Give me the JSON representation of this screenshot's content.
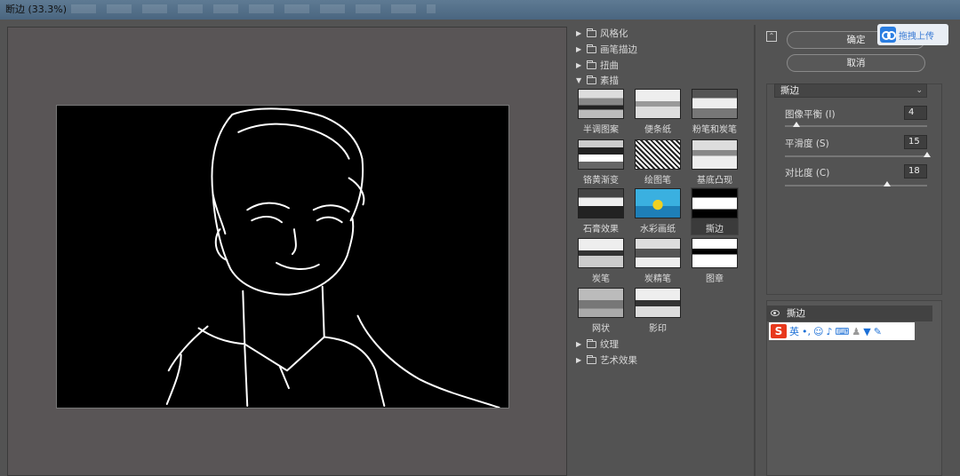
{
  "window": {
    "title": "断边 (33.3%)"
  },
  "filter_gallery": {
    "categories_top": [
      {
        "label": "风格化",
        "expanded": false
      },
      {
        "label": "画笔描边",
        "expanded": false
      },
      {
        "label": "扭曲",
        "expanded": false
      },
      {
        "label": "素描",
        "expanded": true
      }
    ],
    "thumbnails": [
      {
        "label": "半调图案"
      },
      {
        "label": "便条纸"
      },
      {
        "label": "粉笔和炭笔"
      },
      {
        "label": "铬黄渐变"
      },
      {
        "label": "绘图笔"
      },
      {
        "label": "基底凸现"
      },
      {
        "label": "石膏效果"
      },
      {
        "label": "水彩画纸"
      },
      {
        "label": "撕边"
      },
      {
        "label": "炭笔"
      },
      {
        "label": "炭精笔"
      },
      {
        "label": "图章"
      },
      {
        "label": "网状"
      },
      {
        "label": "影印"
      }
    ],
    "categories_bottom": [
      {
        "label": "纹理",
        "expanded": false
      },
      {
        "label": "艺术效果",
        "expanded": false
      }
    ]
  },
  "actions": {
    "ok": "确定",
    "cancel": "取消",
    "upload": "拖拽上传"
  },
  "settings": {
    "filter_select": "撕边",
    "params": [
      {
        "label": "图像平衡 (I)",
        "value": "4",
        "fraction": 0.08
      },
      {
        "label": "平滑度 (S)",
        "value": "15",
        "fraction": 1.0
      },
      {
        "label": "对比度 (C)",
        "value": "18",
        "fraction": 0.72
      }
    ]
  },
  "layers": {
    "item": "撕边"
  },
  "ime": {
    "mode": "英"
  },
  "colors": {
    "background": "#535353",
    "canvas": "#000000",
    "accent": "#2a7de1"
  }
}
